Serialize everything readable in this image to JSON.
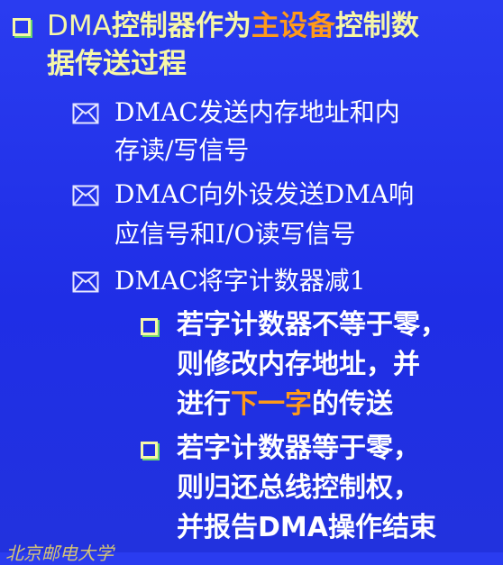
{
  "bullet1": {
    "line1_a": "DMA",
    "line1_b": "控制器作为",
    "line1_hl": "主设备",
    "line1_c": "控制数",
    "line2": "据传送过程"
  },
  "sub1": {
    "line1": "DMAC发送内存地址和内",
    "line2": "存读/写信号"
  },
  "sub2": {
    "line1": "DMAC向外设发送DMA响",
    "line2": "应信号和I/O读写信号"
  },
  "sub3": {
    "line1": "DMAC将字计数器减1"
  },
  "subsub1": {
    "line1": "若字计数器不等于零，",
    "line2": "则修改内存地址，并",
    "line3_a": "进行",
    "line3_hl": "下一字",
    "line3_b": "的传送"
  },
  "subsub2": {
    "line1": "若字计数器等于零，",
    "line2": "则归还总线控制权，",
    "line3": "并报告DMA操作结束"
  },
  "footer": {
    "text": "北京邮电大学"
  },
  "colors": {
    "background": "#2232de",
    "highlight": "#ff9a1a",
    "heading": "#f6f7a8",
    "bullet_shadow": "#6dd86d"
  }
}
